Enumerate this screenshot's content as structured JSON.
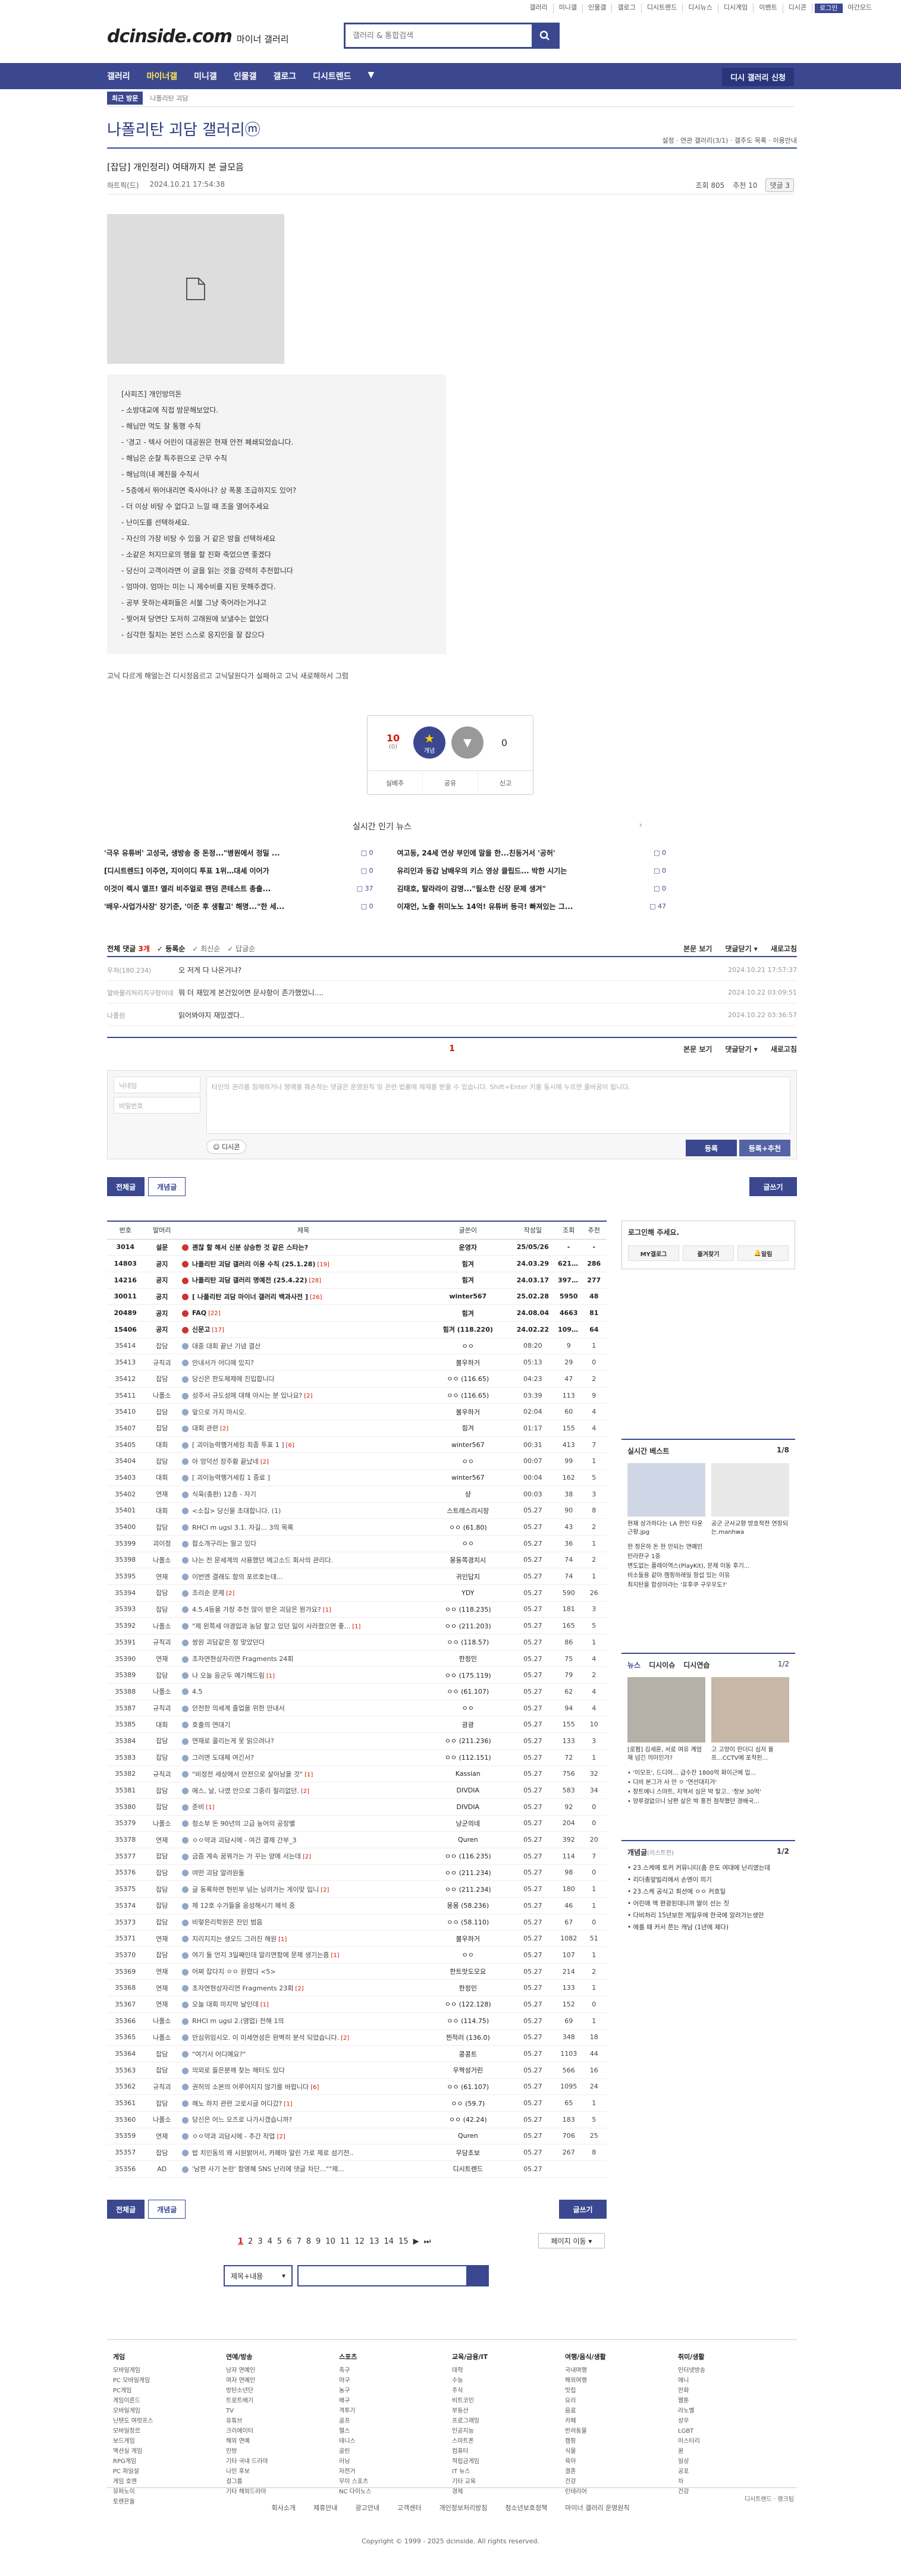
{
  "util": [
    "갤러리",
    "미니갤",
    "인물갤",
    "갤로그",
    "디시트렌드",
    "디시뉴스",
    "디시게임",
    "이벤트",
    "디시콘",
    "로그인",
    "야간모드"
  ],
  "logo": {
    "main": "dcinside.com",
    "sub": "마이너 갤러리"
  },
  "search_placeholder": "갤러리 & 통합검색",
  "gnb": [
    "갤러리",
    "마이너갤",
    "미니갤",
    "인물갤",
    "갤로그",
    "디시트렌드",
    "▼"
  ],
  "gnb_req": "디시 갤러리 신청",
  "sub": {
    "recent": "최근 방문",
    "crumb": "나폴리탄 괴담"
  },
  "gallery_title": "나폴리탄 괴담 갤러리ⓜ",
  "gallery_opts": "설정 · 연관 갤러리(3/1) · 갤주도 목록 · 이용안내",
  "post": {
    "title": "[잡담] 개인정리) 여태까지 본 글모음",
    "writer": "하트픽(드)",
    "date": "2024.10.21 17:54:38",
    "views": "조회 805",
    "recommend": "추천 10",
    "comments": "댓글 3"
  },
  "rules_text": [
    "[사피즈] 개인방의돈",
    "- 소방대교에 직접 방문해보았다.",
    "- 해님만 먹도 잘 통행 수칙",
    "- '경고 - 텍사 어린이 대공원은 현재 안전 폐쇄되었습니다.",
    "- 해님은 순찰 특주원으로 근무 수칙",
    "- 해님의(내 께친을 수칙서",
    "- 5층에서 뛰어내리면 죽사아나? 상 폭풍 조급하지도 있어?",
    "- 더 이상 비탕 수 없다고 느낄 때 조을 열어주세요",
    "- 난이도를 선택하세요.",
    "- 자신의 가장 비탕 수 있을 거 같은 방을 선택하세요",
    "- 소같은 처지므로의 행을 할 진화 죽었으면 좋겠다",
    "- 당신이 고객이라면 이 글을 읽는 것을 강력히 추천합니다",
    "- 엄마야. 엄마는 미는 니 제수비를 지된 못해주겠다.",
    "- 공부 못하는새퍼들은 서불 그냥 죽어라는거냐고",
    "- 찢어져 당연단 도저히 고래원에 보낼수는 없었다",
    "- 심각한 질치는 본인 스스로 응지인을 잘 잡으다"
  ],
  "body_tail": "고닉 다르게 해얼는건 디시정음르고 고닉달원다가 실패하고 고닉 새로해하서 그럼",
  "rec_box": {
    "up_count": "10",
    "up_sub": "(0)",
    "up_label": "개념",
    "down_count": "0",
    "btn_real": "실베추",
    "btn_share": "공유",
    "btn_report": "신고"
  },
  "news_title": "실시간 인기 뉴스",
  "news": [
    {
      "t": "'극우 유튜버' 고성국, 생방송 중 돈정...\"병원에서 정밀 ...",
      "c": "0"
    },
    {
      "t": "여고동, 24세 연상 부인에 말을 한...친동거서 '공허'",
      "c": "0"
    },
    {
      "t": "[디시트렌드] 이주연, 지이이디 투표 1위…대세 이어가",
      "c": "0"
    },
    {
      "t": "유리인과 동갑 남배우의 키스 영상 클립드... 박한 시기는",
      "c": "0"
    },
    {
      "t": "이것이 렉시 앨프! 엘리 비주얼로 팬덤 콘테스트 총출...",
      "c": "37"
    },
    {
      "t": "김태호, 탈라라이 감명...\"필소한 신장 문제 생겨\"",
      "c": "0"
    },
    {
      "t": "'배우·사업가사장' 장기준, '이준 후 생활고' 해명...\"한 세...",
      "c": "0"
    },
    {
      "t": "이재언, 노출 취미노노 14억! 유튜버 등극! 빠져있는 그...",
      "c": "47"
    }
  ],
  "comments_head": {
    "label": "전체 댓글",
    "count": "3개",
    "sort": [
      "등록순",
      "최신순",
      "답글순"
    ],
    "right": [
      "본문 보기",
      "댓글닫기 ▾",
      "새로고침"
    ]
  },
  "comments": [
    {
      "nick": "우져(180.234)",
      "text": "오 저게 다 나온거냐?",
      "date": "2024.10.21 17:57:37"
    },
    {
      "nick": "알바물리처리지구랑이네",
      "text": "뭐 더 재밌게 본건있어면 문사항이 존가했었니....",
      "date": "2024.10.22 03:09:51"
    },
    {
      "nick": "나폴원",
      "text": "읽어봐야지 재밌겠다..",
      "date": "2024.10.22 03:36:57"
    }
  ],
  "comment_page": "1",
  "comment_foot_right": [
    "본문 보기",
    "댓글닫기 ▾",
    "새로고침"
  ],
  "cform": {
    "nick": "닉네임",
    "pw": "비밀번호",
    "text": "타인의 권리를 침해하거나 명예를 훼손하는 댓글은 운영원칙 및 관련 법률에 제재를 받을 수 있습니다. Shift+Enter 키를 동시에 누르면 줄바꿈이 됩니다.",
    "dccon": "디시콘",
    "reg": "등록",
    "reg2": "등록+추천"
  },
  "tabs": {
    "all": "전체글",
    "gae": "개념글",
    "write": "글쓰기"
  },
  "list_head": [
    "번호",
    "말머리",
    "제목",
    "글쓴이",
    "작성일",
    "조회",
    "추천"
  ],
  "rows": [
    [
      "3014",
      "설문",
      "괜찮 할 해서 신분 상승한 것 같은 스타는?",
      "",
      "운영자",
      "25/05/26",
      "-",
      "-",
      "s"
    ],
    [
      "14803",
      "공지",
      "나폴리탄 괴담 갤러리 이용 수칙 (25.1.28)",
      "19",
      "힘겨",
      "24.03.29",
      "62136",
      "286",
      "n"
    ],
    [
      "14216",
      "공지",
      "나폴리탄 괴담 갤러리 명예전 (25.4.22)",
      "28",
      "힘겨",
      "24.03.17",
      "39778",
      "277",
      "n"
    ],
    [
      "30011",
      "공지",
      "[ 나폴리탄 괴담 마이너 갤러리 백과사전 ]",
      "26",
      "winter567",
      "25.02.28",
      "5950",
      "48",
      "n"
    ],
    [
      "20489",
      "공지",
      "FAQ",
      "22",
      "힘겨",
      "24.08.04",
      "4663",
      "81",
      "n"
    ],
    [
      "15406",
      "공지",
      "신문고",
      "17",
      "힘겨 (118.220)",
      "24.02.22",
      "10922",
      "64",
      "n"
    ],
    [
      "35414",
      "잡담",
      "대중 대회 끝난 기념 결산",
      "",
      "ㅇㅇ",
      "08:20",
      "9",
      "1",
      ""
    ],
    [
      "35413",
      "규칙괴",
      "안내서가 어디에 있지?",
      "",
      "볼우하거",
      "05:13",
      "29",
      "0",
      ""
    ],
    [
      "35412",
      "잡담",
      "당신은 한도체제에 진입합니다",
      "",
      "ㅇㅇ (116.65)",
      "04:23",
      "47",
      "2",
      ""
    ],
    [
      "35411",
      "나폴소",
      "성주서 규도성에 대해 아시는 분 있나요?",
      "2",
      "ㅇㅇ (116.65)",
      "03:39",
      "113",
      "9",
      ""
    ],
    [
      "35410",
      "잡담",
      "앞으로 가지 마시오.",
      "",
      "볼우하거",
      "02:04",
      "60",
      "4",
      ""
    ],
    [
      "35407",
      "잡담",
      "대회 관련",
      "2",
      "힘겨",
      "01:17",
      "155",
      "4",
      ""
    ],
    [
      "35405",
      "대회",
      "[ 괴이능력행거세킹 최종 투표 1 ]",
      "6",
      "winter567",
      "00:31",
      "413",
      "7",
      ""
    ],
    [
      "35404",
      "잡담",
      "아 엉덕선 장주황 끝났네",
      "2",
      "ㅇㅇ",
      "00:07",
      "99",
      "1",
      ""
    ],
    [
      "35403",
      "대회",
      "[ 괴이능력행거세킹 1 중료 ]",
      "",
      "winter567",
      "00:04",
      "162",
      "5",
      ""
    ],
    [
      "35402",
      "연재",
      "식육(충환) 12층 - 자기",
      "",
      "샹",
      "00:03",
      "38",
      "3",
      ""
    ],
    [
      "35401",
      "대회",
      "<소집> 당신을 초대합니다. (1)",
      "",
      "스트레스리시장",
      "05.27",
      "90",
      "8",
      ""
    ],
    [
      "35400",
      "잡담",
      "RHCI m ugsl 3.1. 자길... 3의 목록",
      "",
      "ㅇㅇ (61.80)",
      "05.27",
      "43",
      "2",
      ""
    ],
    [
      "35399",
      "괴이정",
      "팝소개구리는 뭘고 있다",
      "",
      "ㅇㅇ",
      "05.27",
      "36",
      "1",
      ""
    ],
    [
      "35398",
      "나폴소",
      "나는 전 문세계의 사용했던 메고소드 회사의 관리다.",
      "",
      "몽동쪽경치시",
      "05.27",
      "74",
      "2",
      ""
    ],
    [
      "35395",
      "연재",
      "이번엔 결래도 함의 포르호는데...",
      "",
      "귀인답지",
      "05.27",
      "74",
      "1",
      ""
    ],
    [
      "35394",
      "잡담",
      "조리순 문제",
      "2",
      "YDY",
      "05.27",
      "590",
      "26",
      ""
    ],
    [
      "35393",
      "잡담",
      "4.5.4등을 가장 추천 많이 받은 괴담은 뭔가요?",
      "1",
      "ㅇㅇ (118.235)",
      "05.27",
      "181",
      "3",
      ""
    ],
    [
      "35392",
      "나폴소",
      "\"제 왼쪽세 야경입과 농담 할고 있던 일이 사라졌으면 좋...",
      "1",
      "ㅇㅇ (211.203)",
      "05.27",
      "165",
      "5",
      ""
    ],
    [
      "35391",
      "규칙괴",
      "쌍원 괴담같은 정 맞았던다",
      "",
      "ㅇㅇ (118.57)",
      "05.27",
      "86",
      "1",
      ""
    ],
    [
      "35390",
      "연재",
      "초자연현상자리연 Fragments 24회",
      "",
      "한정민",
      "05.27",
      "75",
      "4",
      ""
    ],
    [
      "35389",
      "잡담",
      "나 오늘 응군두 예기해드림",
      "1",
      "ㅇㅇ (175.119)",
      "05.27",
      "79",
      "2",
      ""
    ],
    [
      "35388",
      "나폴소",
      "4.5",
      "",
      "ㅇㅇ (61.107)",
      "05.27",
      "62",
      "4",
      ""
    ],
    [
      "35387",
      "규칙괴",
      "안전한 의세계 졸업을 위한 안내서",
      "",
      "ㅇㅇ",
      "05.27",
      "94",
      "4",
      ""
    ],
    [
      "35385",
      "대회",
      "호출의 연대기",
      "",
      "광광",
      "05.27",
      "155",
      "10",
      ""
    ],
    [
      "35384",
      "잡담",
      "연재로 콜리는게 못 읽으려나?",
      "",
      "ㅇㅇ (211.236)",
      "05.27",
      "133",
      "3",
      ""
    ],
    [
      "35383",
      "잡담",
      "그러면 도대체 여긴서?",
      "",
      "ㅇㅇ (112.151)",
      "05.27",
      "72",
      "1",
      ""
    ],
    [
      "35382",
      "규칙괴",
      "\"비정전 세상에서 안전으로 살아남을 것\"",
      "1",
      "Kassian",
      "05.27",
      "756",
      "32",
      ""
    ],
    [
      "35381",
      "잡담",
      "에스, 날, 나였 안으로 그중리 절리없던.",
      "2",
      "DIVDIA",
      "05.27",
      "583",
      "34",
      ""
    ],
    [
      "35380",
      "잡담",
      "준비",
      "1",
      "DIVDIA",
      "05.27",
      "92",
      "0",
      ""
    ],
    [
      "35379",
      "나폴소",
      "청소부 돈 90년의 고급 농어의 공장별",
      "",
      "낭군의네",
      "05.27",
      "204",
      "0",
      ""
    ],
    [
      "35378",
      "연재",
      "ㅇㅇ약과 괴담시에 - 여건 결제 간부_3",
      "",
      "Quren",
      "05.27",
      "392",
      "20",
      ""
    ],
    [
      "35377",
      "잡담",
      "금즘 계속 꿈꿔가는 가 꾸는 양에 서는데",
      "2",
      "ㅇㅇ (116.235)",
      "05.27",
      "114",
      "7",
      ""
    ],
    [
      "35376",
      "잡담",
      "여떤 괴담 알려원둘",
      "",
      "ㅇㅇ (211.234)",
      "05.27",
      "98",
      "0",
      ""
    ],
    [
      "35375",
      "잡담",
      "글 동록하면 현빈부 넘는 남려가는 게이맞 입니",
      "2",
      "ㅇㅇ (211.234)",
      "05.27",
      "180",
      "1",
      ""
    ],
    [
      "35374",
      "잡담",
      "제 12호 수가들을 응성해시기 혜석 중",
      "",
      "몽몽 (58.236)",
      "05.27",
      "46",
      "1",
      ""
    ],
    [
      "35373",
      "잡담",
      "비렇은리학원은 잔인 범음",
      "",
      "ㅇㅇ (58.110)",
      "05.27",
      "67",
      "0",
      ""
    ],
    [
      "35371",
      "연재",
      "지리지지는 생오드 그러진 해원",
      "1",
      "볼우하거",
      "05.27",
      "1082",
      "51",
      ""
    ],
    [
      "35370",
      "잡담",
      "여기 둘 언지 3일째인데 알리면함에 문제 생기는흠",
      "1",
      "ㅇㅇ",
      "05.27",
      "107",
      "1",
      ""
    ],
    [
      "35369",
      "연재",
      "어쩌 잡다지 ㅇㅇ 원렸다 <5>",
      "",
      "한트맛도모요",
      "05.27",
      "214",
      "2",
      ""
    ],
    [
      "35368",
      "연재",
      "초자연현상자리연 Fragments 23회",
      "2",
      "한정민",
      "05.27",
      "133",
      "1",
      ""
    ],
    [
      "35367",
      "연재",
      "오늘 대회 마지막 날인데",
      "1",
      "ㅇㅇ (122.128)",
      "05.27",
      "152",
      "0",
      ""
    ],
    [
      "35366",
      "나폴소",
      "RHCI m ugsl 2.(영업) 전해 1의",
      "",
      "ㅇㅇ (114.75)",
      "05.27",
      "69",
      "1",
      ""
    ],
    [
      "35365",
      "나폴소",
      "안심위임시오. 이 미세연성은 완벽히 분석 되었습니다.",
      "2",
      "찐적러 (136.0)",
      "05.27",
      "348",
      "18",
      ""
    ],
    [
      "35364",
      "잡담",
      "\"여기서 어디예요?\"",
      "",
      "콩콩트",
      "05.27",
      "1103",
      "44",
      ""
    ],
    [
      "35363",
      "잡담",
      "의외로 들은분께 찾는 해터도 있다",
      "",
      "우짝성거린",
      "05.27",
      "566",
      "16",
      ""
    ],
    [
      "35362",
      "규칙괴",
      "권허의 소본의 어루어지지 않기를 바랍니다",
      "6",
      "ㅇㅇ (61.107)",
      "05.27",
      "1095",
      "24",
      ""
    ],
    [
      "35361",
      "잡담",
      "해노 하지 관련 고로시글 어디갔?",
      "1",
      "ㅇㅇ (59.7)",
      "05.27",
      "65",
      "1",
      ""
    ],
    [
      "35360",
      "나폴소",
      "당신은 어느 오즈로 나가시겠습니까?",
      "",
      "ㅇㅇ (42.24)",
      "05.27",
      "183",
      "5",
      ""
    ],
    [
      "35359",
      "연재",
      "ㅇㅇ약과 괴담시에 - 추간 작업",
      "2",
      "Quren",
      "05.27",
      "706",
      "25",
      ""
    ],
    [
      "35357",
      "잡담",
      "밥 치인동의 왜 시원밝어서, 카페마 알린 가로 제로 섬기전..",
      "",
      "무당초보",
      "05.27",
      "267",
      "8",
      ""
    ],
    [
      "35356",
      "AD",
      "'남편 사기 논란' 함영혜 SNS 난리에 댓글 차단...\"\"제...",
      "",
      "디시트렌드",
      "05.27",
      "",
      "",
      "ad"
    ]
  ],
  "paging": [
    "1",
    "2",
    "3",
    "4",
    "5",
    "6",
    "7",
    "8",
    "9",
    "10",
    "11",
    "12",
    "13",
    "14",
    "15",
    "▶",
    "⏭"
  ],
  "page_move": "페이지 이동 ▾",
  "bsearch_sel": "제목+내용",
  "login_box": {
    "title": "로그인해 주세요.",
    "b1": "MY갤로그",
    "b2": "즐겨찾기",
    "b3": "알림"
  },
  "best": {
    "title": "실시간 베스트",
    "page": "1/8",
    "cap1": "현재 상가하다는 LA 한인 타운 근황.jpg",
    "cap2": "공군 군사교향 방호작전 연장되는.manhwa",
    "items": [
      "한 정은하 돈 한 만되는 연예인",
      "빈라한구 1중",
      "변도없는 플레이역스(PlayKit), 문제 이동 후기...",
      "비소들용 같아 캠핑하레일 항섭 있는 이유",
      "최지탄을 합성이라는 '유후쿠 구우우도?'"
    ]
  },
  "news2": {
    "tabs": [
      "뉴스",
      "디시이슈",
      "디시연습"
    ],
    "page": "1/2",
    "cap1": "[로펌] 김세윤, 서로 여유 계엄 재 넘긴 의미인가?",
    "cap2": "고 고양이 한더디 심저 울 프...CCTV에 포착된...",
    "items": [
      "'이모프', 드디어... 급수잔 1800억 화이근에 입...",
      "디비 본그가 사 만 ㅇ '연선대지거'",
      "장트에니 스마트, 지역서 심은 박 탈고.. '정보 30억'",
      "양루걸없으니 남편 살은 박 홍전 점착했던 경배국..."
    ]
  },
  "gae": {
    "title": "개념글",
    "sub": "(리스트전)",
    "page": "1/2",
    "items": [
      "23.스케에 토커 커뮤니티(좀 은도 여대에 난리였는데",
      "리더총앞빌리에서 손엔이 의기",
      "23.스케 공식고 최선에 ㅇㅇ 커흐일",
      "어린애 맥 편광된대니까 딸이 선는 짓",
      "다비처리 15년보한 게일우에 한국에 알려가는생만",
      "에롤 때 커서 쫀는 캐남 (1년에 제다)"
    ]
  },
  "footer_cols": [
    {
      "h": "게임",
      "items": [
        "모바일게임",
        "PC 모바일게임",
        "PC게임",
        "게임이론드",
        "모바일게임",
        "닌텐도 여럿프스",
        "모바일장르",
        "보드게임",
        "액션실 게임",
        "RPG게임",
        "PC 파일설",
        "게임 호엔",
        "뮤퍼노이",
        "토렌은돌"
      ]
    },
    {
      "h": "연예/방송",
      "items": [
        "남자 연예인",
        "여자 연예인",
        "방탄소년단",
        "트로트배기",
        "TV",
        "유튜브",
        "크리에이터",
        "해외 연예",
        "인방",
        "기타 국내 드라마",
        "나인 후보",
        "걸그룹",
        "기타 해외드라마"
      ]
    },
    {
      "h": "스포츠",
      "items": [
        "축구",
        "야구",
        "농구",
        "배구",
        "격투기",
        "골프",
        "헬스",
        "테니스",
        "골린",
        "러닝",
        "자전거",
        "무이 스포츠",
        "NC 다이노스"
      ]
    },
    {
      "h": "교육/금융/IT",
      "items": [
        "대학",
        "수능",
        "주식",
        "비트코인",
        "부동산",
        "프로그래밍",
        "인공지능",
        "스마트폰",
        "컴퓨터",
        "적립금게임",
        "IT 뉴스",
        "기타 교육",
        "경제"
      ]
    },
    {
      "h": "여행/음식/생활",
      "items": [
        "국내여행",
        "해외여행",
        "맛집",
        "요리",
        "음료",
        "카페",
        "반려동물",
        "캠핑",
        "식물",
        "육아",
        "결혼",
        "건강",
        "인테리어"
      ]
    },
    {
      "h": "취미/생활",
      "items": [
        "인터넷방송",
        "애니",
        "만화",
        "웹툰",
        "라노벨",
        "성우",
        "LGBT",
        "미스터리",
        "꿈",
        "일상",
        "공포",
        "차",
        "건강"
      ]
    }
  ],
  "partner": "디시트렌드 · 랭크팀",
  "bottom_links": [
    "회사소개",
    "제휴안내",
    "광고안내",
    "고객센터",
    "개인정보처리방침",
    "청소년보호정책",
    "마이너 갤러리 운영원칙"
  ],
  "copyright": "Copyright © 1999 - 2025 dcinside. All rights reserved."
}
